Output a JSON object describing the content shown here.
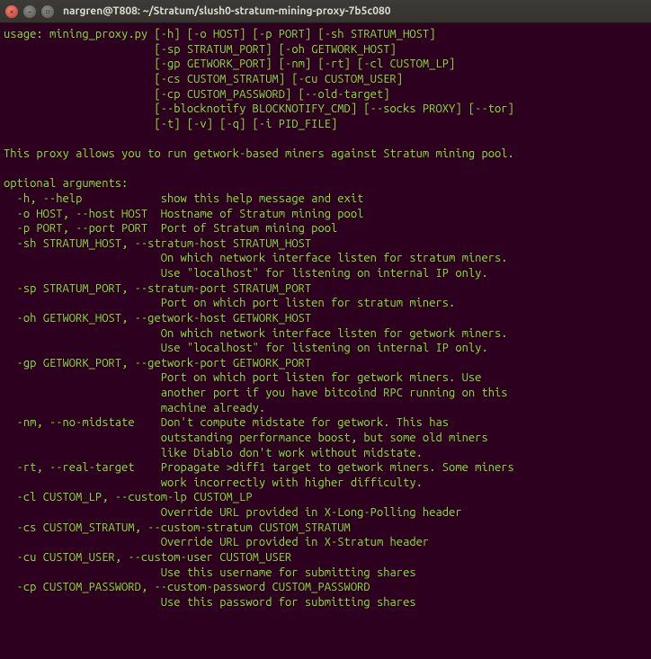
{
  "titlebar": {
    "title": "nargren@T808: ~/Stratum/slush0-stratum-mining-proxy-7b5c080",
    "buttons": {
      "close": "×",
      "min": "–",
      "max": "▫"
    }
  },
  "usage": {
    "lead": "usage: mining_proxy.py ",
    "lines": [
      "[-h] [-o HOST] [-p PORT] [-sh STRATUM_HOST]",
      "[-sp STRATUM_PORT] [-oh GETWORK_HOST]",
      "[-gp GETWORK_PORT] [-nm] [-rt] [-cl CUSTOM_LP]",
      "[-cs CUSTOM_STRATUM] [-cu CUSTOM_USER]",
      "[-cp CUSTOM_PASSWORD] [--old-target]",
      "[--blocknotify BLOCKNOTIFY_CMD] [--socks PROXY] [--tor]",
      "[-t] [-v] [-q] [-i PID_FILE]"
    ],
    "indent": "                       "
  },
  "description": "This proxy allows you to run getwork-based miners against Stratum mining pool.",
  "optional_header": "optional arguments:",
  "args": [
    {
      "flag": "  -h, --help",
      "col": 24,
      "desc": [
        "show this help message and exit"
      ]
    },
    {
      "flag": "  -o HOST, --host HOST",
      "col": 24,
      "desc": [
        "Hostname of Stratum mining pool"
      ]
    },
    {
      "flag": "  -p PORT, --port PORT",
      "col": 24,
      "desc": [
        "Port of Stratum mining pool"
      ]
    },
    {
      "flag": "  -sh STRATUM_HOST, --stratum-host STRATUM_HOST",
      "wrap": true,
      "col": 24,
      "desc": [
        "On which network interface listen for stratum miners.",
        "Use \"localhost\" for listening on internal IP only."
      ]
    },
    {
      "flag": "  -sp STRATUM_PORT, --stratum-port STRATUM_PORT",
      "wrap": true,
      "col": 24,
      "desc": [
        "Port on which port listen for stratum miners."
      ]
    },
    {
      "flag": "  -oh GETWORK_HOST, --getwork-host GETWORK_HOST",
      "wrap": true,
      "col": 24,
      "desc": [
        "On which network interface listen for getwork miners.",
        "Use \"localhost\" for listening on internal IP only."
      ]
    },
    {
      "flag": "  -gp GETWORK_PORT, --getwork-port GETWORK_PORT",
      "wrap": true,
      "col": 24,
      "desc": [
        "Port on which port listen for getwork miners. Use",
        "another port if you have bitcoind RPC running on this",
        "machine already."
      ]
    },
    {
      "flag": "  -nm, --no-midstate",
      "col": 24,
      "desc": [
        "Don't compute midstate for getwork. This has",
        "outstanding performance boost, but some old miners",
        "like Diablo don't work without midstate."
      ]
    },
    {
      "flag": "  -rt, --real-target",
      "col": 24,
      "desc": [
        "Propagate >diff1 target to getwork miners. Some miners",
        "work incorrectly with higher difficulty."
      ]
    },
    {
      "flag": "  -cl CUSTOM_LP, --custom-lp CUSTOM_LP",
      "wrap": true,
      "col": 24,
      "desc": [
        "Override URL provided in X-Long-Polling header"
      ]
    },
    {
      "flag": "  -cs CUSTOM_STRATUM, --custom-stratum CUSTOM_STRATUM",
      "wrap": true,
      "col": 24,
      "desc": [
        "Override URL provided in X-Stratum header"
      ]
    },
    {
      "flag": "  -cu CUSTOM_USER, --custom-user CUSTOM_USER",
      "wrap": true,
      "col": 24,
      "desc": [
        "Use this username for submitting shares"
      ]
    },
    {
      "flag": "  -cp CUSTOM_PASSWORD, --custom-password CUSTOM_PASSWORD",
      "wrap": true,
      "col": 24,
      "desc": [
        "Use this password for submitting shares"
      ]
    }
  ]
}
